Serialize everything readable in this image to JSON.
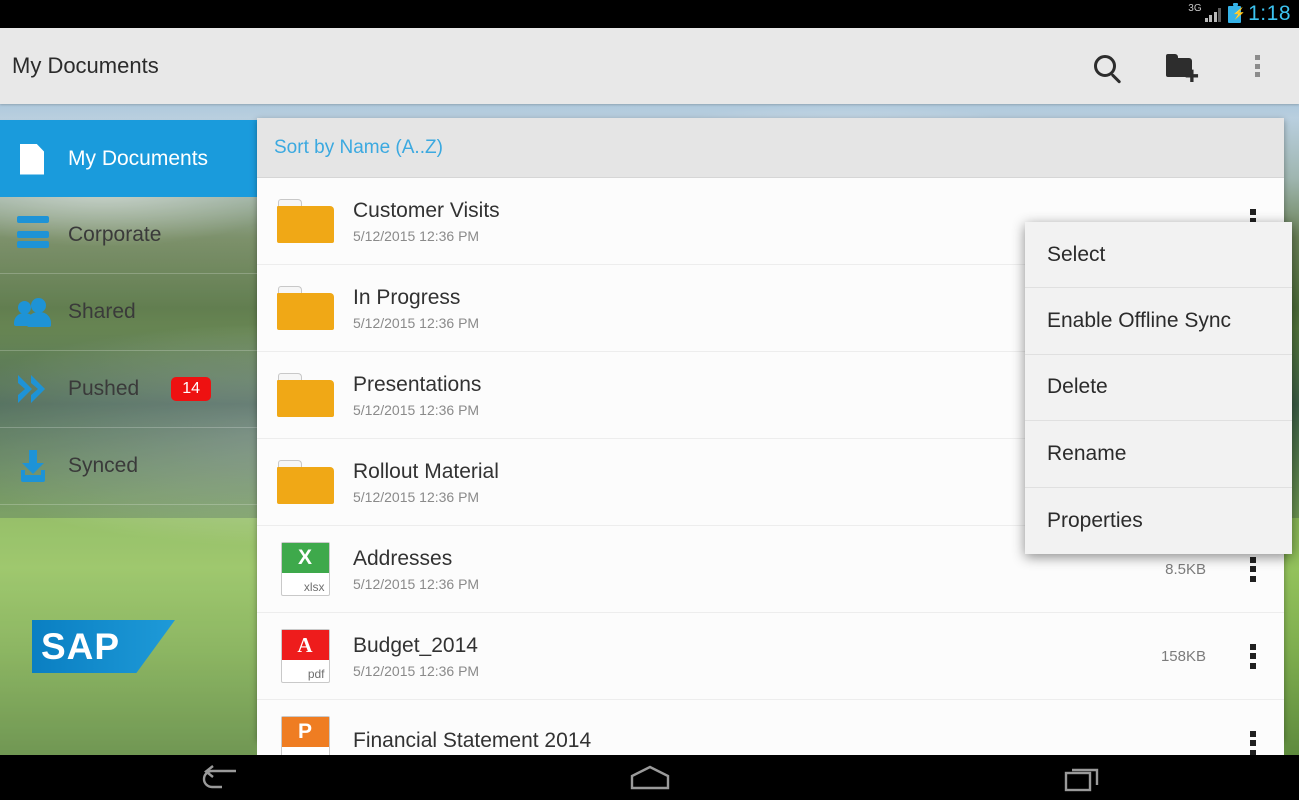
{
  "statusbar": {
    "network_label": "3G",
    "clock": "1:18",
    "battery_icon": "battery-charging-icon",
    "signal_icon": "signal-bars-icon"
  },
  "actionbar": {
    "title": "My Documents",
    "actions": [
      {
        "name": "search-button",
        "icon": "search-icon",
        "label": "Search"
      },
      {
        "name": "new-folder-button",
        "icon": "new-folder-icon",
        "label": "New Folder"
      },
      {
        "name": "overflow-button",
        "icon": "overflow-dots-icon",
        "label": "More options"
      }
    ]
  },
  "sidebar": {
    "items": [
      {
        "label": "My Documents",
        "icon": "document-icon",
        "selected": true,
        "badge": ""
      },
      {
        "label": "Corporate",
        "icon": "server-stack-icon",
        "selected": false,
        "badge": ""
      },
      {
        "label": "Shared",
        "icon": "people-icon",
        "selected": false,
        "badge": ""
      },
      {
        "label": "Pushed",
        "icon": "double-chevron-icon",
        "selected": false,
        "badge": "14"
      },
      {
        "label": "Synced",
        "icon": "download-icon",
        "selected": false,
        "badge": ""
      }
    ],
    "logo_text": "SAP"
  },
  "main": {
    "sort_label": "Sort by Name  (A..Z)",
    "rows": [
      {
        "name": "Customer Visits",
        "date": "5/12/2015 12:36 PM",
        "size": "",
        "type": "folder",
        "ext": ""
      },
      {
        "name": "In Progress",
        "date": "5/12/2015 12:36 PM",
        "size": "",
        "type": "folder",
        "ext": ""
      },
      {
        "name": "Presentations",
        "date": "5/12/2015 12:36 PM",
        "size": "",
        "type": "folder",
        "ext": ""
      },
      {
        "name": "Rollout Material",
        "date": "5/12/2015 12:36 PM",
        "size": "",
        "type": "folder",
        "ext": ""
      },
      {
        "name": "Addresses",
        "date": "5/12/2015 12:36 PM",
        "size": "8.5KB",
        "type": "xlsx",
        "ext": "xlsx",
        "glyph": "X"
      },
      {
        "name": "Budget_2014",
        "date": "5/12/2015 12:36 PM",
        "size": "158KB",
        "type": "pdf",
        "ext": "pdf",
        "glyph": "A"
      },
      {
        "name": "Financial Statement 2014",
        "date": "",
        "size": "",
        "type": "pptx",
        "ext": "pptx",
        "glyph": "P"
      }
    ]
  },
  "context_menu": {
    "items": [
      {
        "label": "Select"
      },
      {
        "label": "Enable Offline Sync"
      },
      {
        "label": "Delete"
      },
      {
        "label": "Rename"
      },
      {
        "label": "Properties"
      }
    ]
  },
  "navbar": {
    "buttons": [
      {
        "name": "back-button",
        "icon": "back-arrow-icon",
        "label": "Back"
      },
      {
        "name": "home-button",
        "icon": "home-icon",
        "label": "Home"
      },
      {
        "name": "recents-button",
        "icon": "recents-icon",
        "label": "Recent apps"
      }
    ]
  },
  "colors": {
    "accent_blue": "#1a9bdc",
    "link_blue": "#3ba9e0",
    "folder_orange": "#f0a816",
    "badge_red": "#ee1111",
    "excel_green": "#3ea94b",
    "pdf_red": "#ee1c1c",
    "ppt_orange": "#ef7d22"
  }
}
